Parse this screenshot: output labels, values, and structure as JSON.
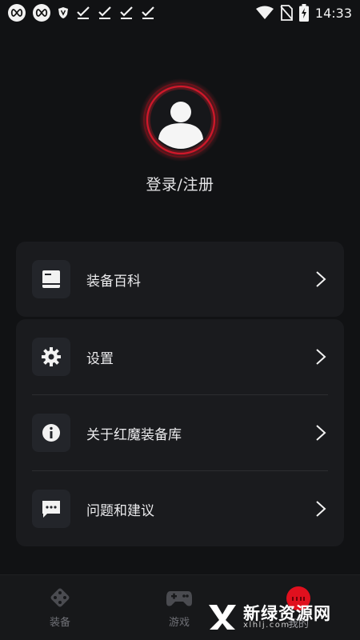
{
  "status_bar": {
    "time": "14:33",
    "icons": [
      "infinity-app-icon",
      "infinity-app-icon",
      "shield-app-icon",
      "download-done-icon",
      "download-done-icon",
      "download-done-icon",
      "download-done-icon",
      "wifi-icon",
      "no-sim-icon",
      "battery-charging-icon"
    ]
  },
  "profile": {
    "login_label": "登录/注册",
    "avatar_ring_color": "#d0182a"
  },
  "menu": {
    "card1": [
      {
        "label": "装备百科",
        "icon": "book-icon"
      }
    ],
    "card2": [
      {
        "label": "设置",
        "icon": "gear-icon"
      },
      {
        "label": "关于红魔装备库",
        "icon": "info-icon"
      },
      {
        "label": "问题和建议",
        "icon": "feedback-icon"
      }
    ]
  },
  "bottom_nav": {
    "items": [
      {
        "label": "装备",
        "icon": "dice-icon"
      },
      {
        "label": "游戏",
        "icon": "gamepad-icon"
      },
      {
        "label": "我的",
        "icon": "profile-badge-icon"
      }
    ],
    "accent": "#e0101e"
  },
  "watermark": {
    "main": "新绿资源网",
    "sub": "xlhlj.com"
  }
}
